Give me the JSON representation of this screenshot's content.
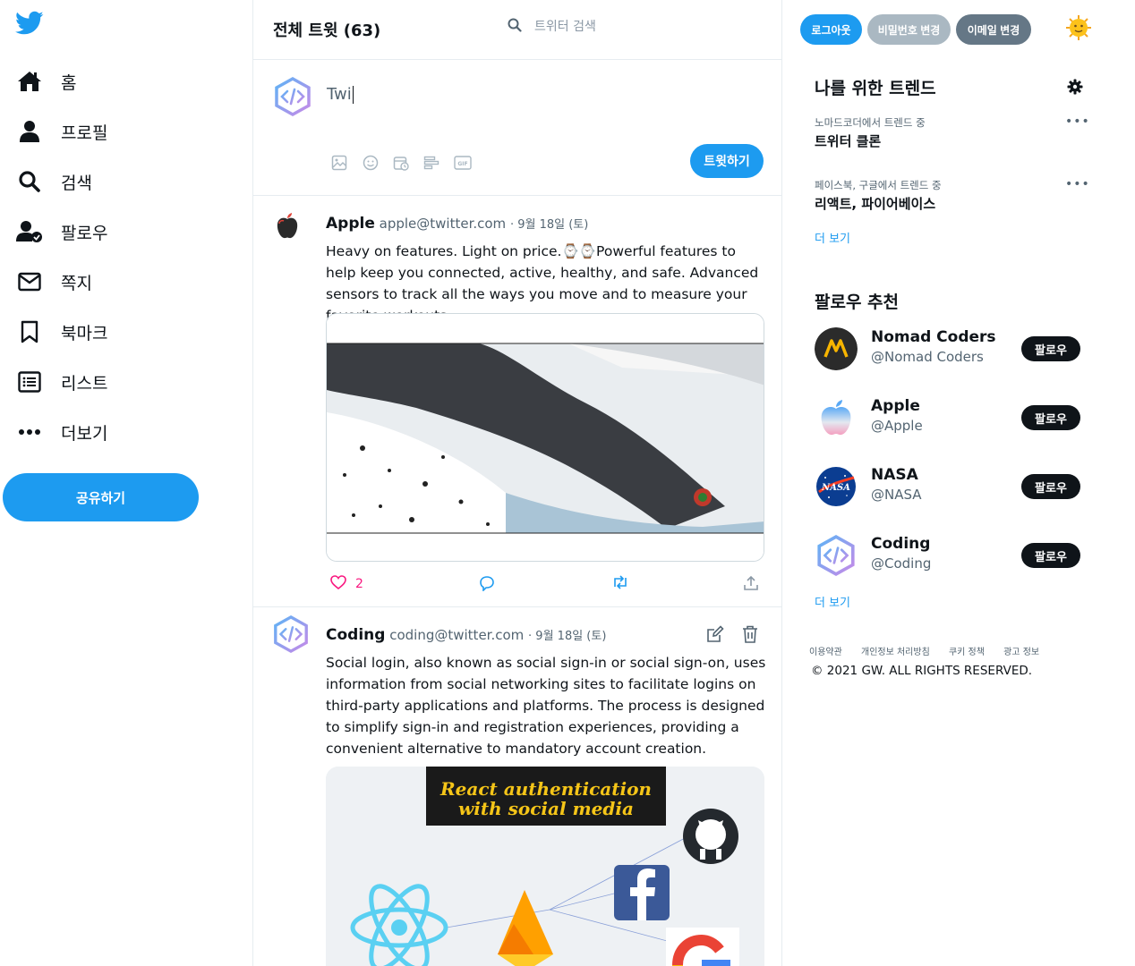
{
  "nav": {
    "items": [
      {
        "label": "홈",
        "icon": "home-icon"
      },
      {
        "label": "프로필",
        "icon": "user-icon"
      },
      {
        "label": "검색",
        "icon": "search-icon"
      },
      {
        "label": "팔로우",
        "icon": "follow-icon"
      },
      {
        "label": "쪽지",
        "icon": "mail-icon"
      },
      {
        "label": "북마크",
        "icon": "bookmark-icon"
      },
      {
        "label": "리스트",
        "icon": "list-icon"
      },
      {
        "label": "더보기",
        "icon": "more-icon"
      }
    ],
    "share_label": "공유하기"
  },
  "header": {
    "title": "전체 트윗 (63)",
    "search_placeholder": "트위터 검색"
  },
  "composer": {
    "text": "Twi",
    "tweet_label": "트윗하기"
  },
  "tweets": [
    {
      "name": "Apple",
      "handle": "apple@twitter.com",
      "date": "· 9월 18일 (토)",
      "body_1": "Heavy on features. Light on price.",
      "body_emoji": "⌚⌚",
      "body_2": "Powerful features to help keep you connected, active, healthy, and safe. Advanced sensors to track all the ways you move and to measure your favorite workouts.",
      "likes": "2"
    },
    {
      "name": "Coding",
      "handle": "coding@twitter.com",
      "date": "· 9월 18일 (토)",
      "body": "Social login, also known as social sign-in or social sign-on, uses information from social networking sites to facilitate logins on third-party applications and platforms. The process is designed to simplify sign-in and registration experiences, providing a convenient alternative to mandatory account creation.",
      "media_title_1": "React authentication",
      "media_title_2": "with social media"
    }
  ],
  "account": {
    "logout": "로그아웃",
    "change_password": "비밀번호 변경",
    "change_email": "이메일 변경"
  },
  "trends": {
    "title": "나를 위한 트렌드",
    "items": [
      {
        "context": "노마드코더에서 트렌드 중",
        "name": "트위터 클론"
      },
      {
        "context": "페이스북, 구글에서 트렌드 중",
        "name": "리액트, 파이어베이스"
      }
    ],
    "more": "더 보기"
  },
  "follow": {
    "title": "팔로우 추천",
    "button": "팔로우",
    "items": [
      {
        "name": "Nomad Coders",
        "handle": "@Nomad Coders"
      },
      {
        "name": "Apple",
        "handle": "@Apple"
      },
      {
        "name": "NASA",
        "handle": "@NASA"
      },
      {
        "name": "Coding",
        "handle": "@Coding"
      }
    ],
    "more": "더 보기"
  },
  "footer": {
    "links": [
      "이용약관",
      "개인정보 처리방침",
      "쿠키 정책",
      "광고 정보"
    ],
    "copyright": "© 2021 GW. ALL RIGHTS RESERVED."
  },
  "colors": {
    "accent": "#1d9bf0",
    "pill_gray": "#aab8c2",
    "pill_dark": "#657786",
    "like": "#f91880"
  }
}
